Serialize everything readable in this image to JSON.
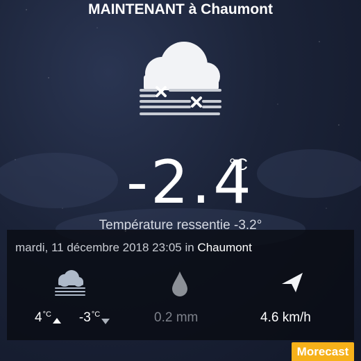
{
  "header": {
    "title": "MAINTENANT à Chaumont"
  },
  "current": {
    "condition_icon": "cloud-fog-freezing-icon",
    "temperature": "-2.4",
    "temperature_unit": "°C",
    "feels_like": "Température ressentie -3.2°"
  },
  "details": {
    "date_prefix": "mardi, 11 décembre 2018 23:05 in",
    "city": "Chaumont",
    "forecast_icon": "cloud-fog-icon",
    "temp_max": "4",
    "temp_max_unit": "°C",
    "temp_min": "-3",
    "temp_min_unit": "°C",
    "rain_icon": "raindrop-icon",
    "rain": "0.2 mm",
    "wind_icon": "wind-direction-arrow-icon",
    "wind": "4.6 km/h"
  },
  "brand": {
    "label": "Morecast",
    "color": "#f6b11a"
  }
}
